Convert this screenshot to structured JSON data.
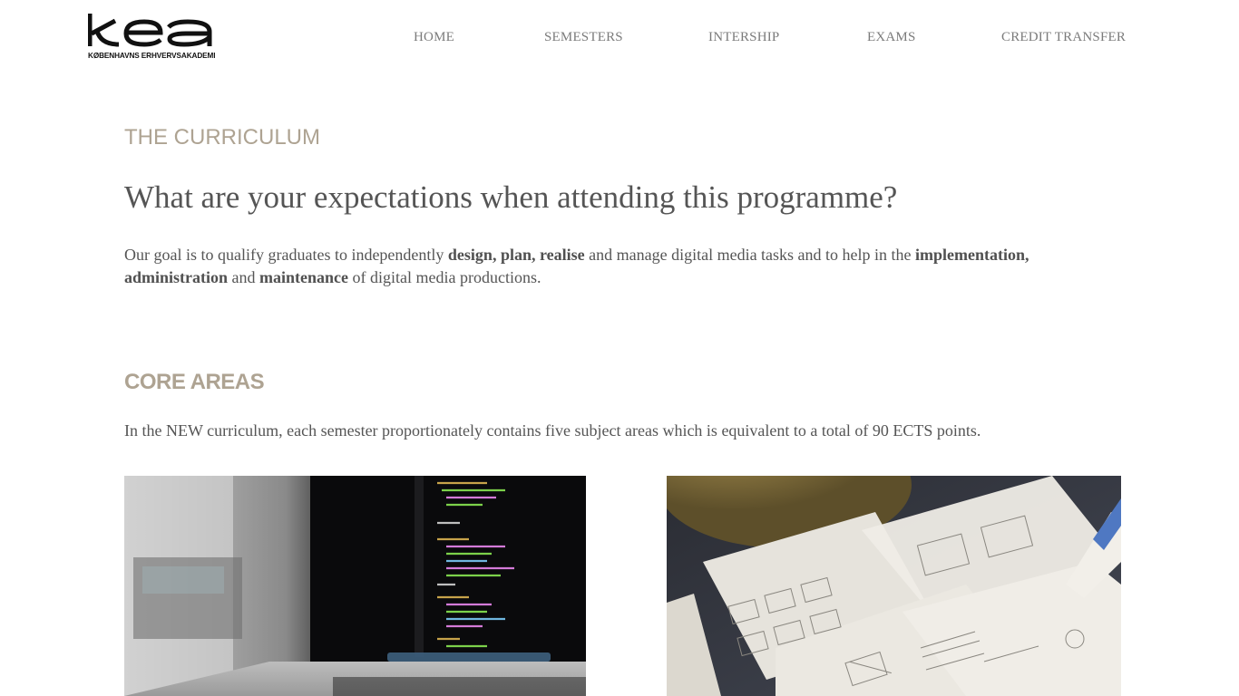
{
  "logo": {
    "wordmark": "kea",
    "subtitle": "KØBENHAVNS ERHVERVSAKADEMI"
  },
  "nav": {
    "items": [
      {
        "label": "HOME"
      },
      {
        "label": "SEMESTERS"
      },
      {
        "label": "INTERSHIP"
      },
      {
        "label": "EXAMS"
      },
      {
        "label": "CREDIT TRANSFER"
      }
    ]
  },
  "curriculum": {
    "title": "THE CURRICULUM",
    "heading": "What are your expectations when attending this programme?",
    "goal": {
      "t1": "Our goal is to qualify graduates to independently ",
      "b1": "design, plan, realise",
      "t2": " and manage digital media tasks and to help in the ",
      "b2": "implementation, administration",
      "t3": " and ",
      "b3": "maintenance",
      "t4": " of digital media productions."
    }
  },
  "core": {
    "title": "CORE AREAS",
    "text": "In the NEW curriculum, each semester proportionately contains five subject areas which is equivalent to a total of 90 ECTS points."
  },
  "images": {
    "left": "laptop-with-code-photo",
    "right": "wireframe-sketches-photo"
  },
  "colors": {
    "accent": "#aea392",
    "text": "#555555",
    "nav": "#7b7b7b",
    "logo": "#111111"
  }
}
